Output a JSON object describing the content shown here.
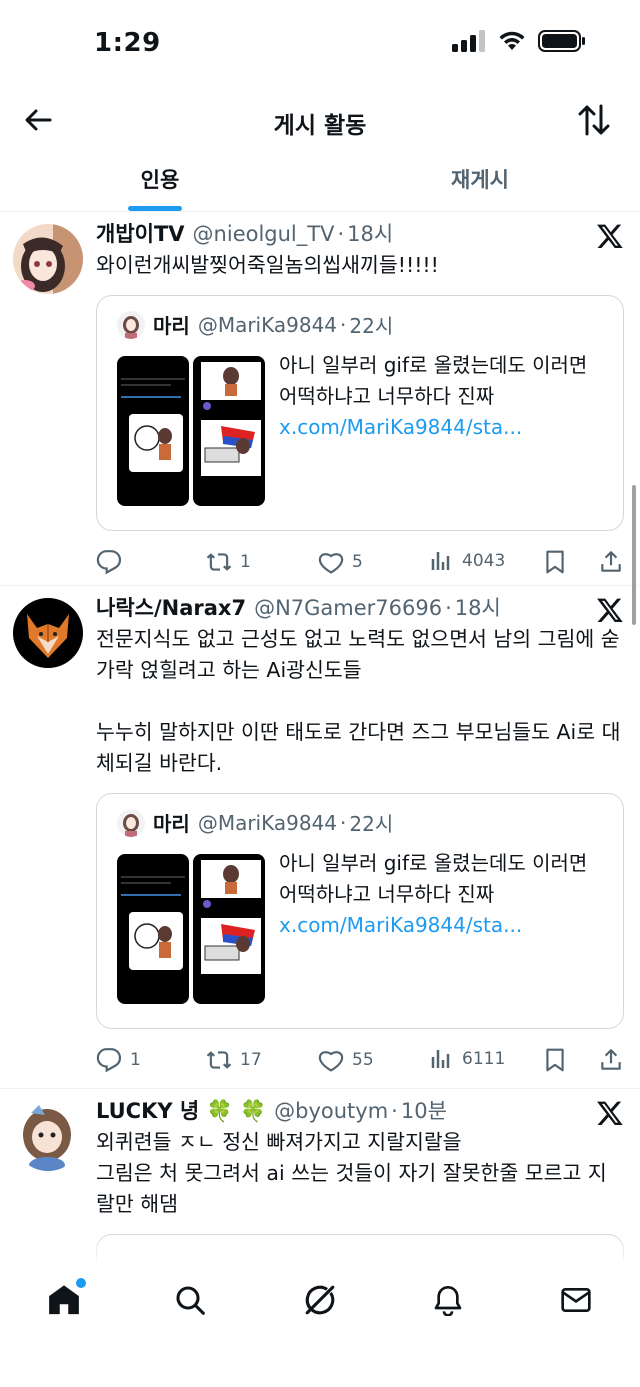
{
  "status_bar": {
    "time": "1:29"
  },
  "header": {
    "title": "게시 활동"
  },
  "tabs": [
    {
      "label": "인용",
      "active": true
    },
    {
      "label": "재게시",
      "active": false
    }
  ],
  "quoted_tweet": {
    "name": "마리",
    "handle": "@MariKa9844",
    "time": "22시",
    "text": "아니 일부러 gif로 올렸는데도 이러면 어떡하냐고 너무하다 진짜",
    "link": "x.com/MariKa9844/sta..."
  },
  "tweets": [
    {
      "name": "개밥이TV",
      "handle": "@nieolgul_TV",
      "time": "18시",
      "text": "와이런개씨발찢어죽일놈의씹새끼들!!!!!",
      "replies": "",
      "reposts": "1",
      "likes": "5",
      "views": "4043"
    },
    {
      "name": "나락스/Narax7",
      "handle": "@N7Gamer76696",
      "time": "18시",
      "text": "전문지식도 없고 근성도 없고 노력도 없으면서 남의 그림에 숟가락 얹힐려고 하는 Ai광신도들\n\n누누히 말하지만 이딴 태도로 간다면 즈그 부모님들도 Ai로 대체되길 바란다.",
      "replies": "1",
      "reposts": "17",
      "likes": "55",
      "views": "6111"
    },
    {
      "name": "LUCKY 녕 🍀 🍀",
      "handle": "@byoutym",
      "time": "10분",
      "text": "외퀴련들 ㅈㄴ 정신 빠져가지고 지랄지랄을\n그림은 처 못그려서 ai 쓰는 것들이 자기 잘못한줄 모르고 지랄만 해댐"
    }
  ],
  "colors": {
    "accent": "#1d9bf0",
    "text": "#0f1419",
    "secondary": "#536471",
    "border": "#cfd9de"
  },
  "icons": [
    "back-arrow-icon",
    "sort-icon",
    "x-logo-icon",
    "reply-icon",
    "repost-icon",
    "like-icon",
    "views-icon",
    "bookmark-icon",
    "share-icon",
    "home-icon",
    "search-icon",
    "grok-icon",
    "notifications-icon",
    "messages-icon"
  ]
}
